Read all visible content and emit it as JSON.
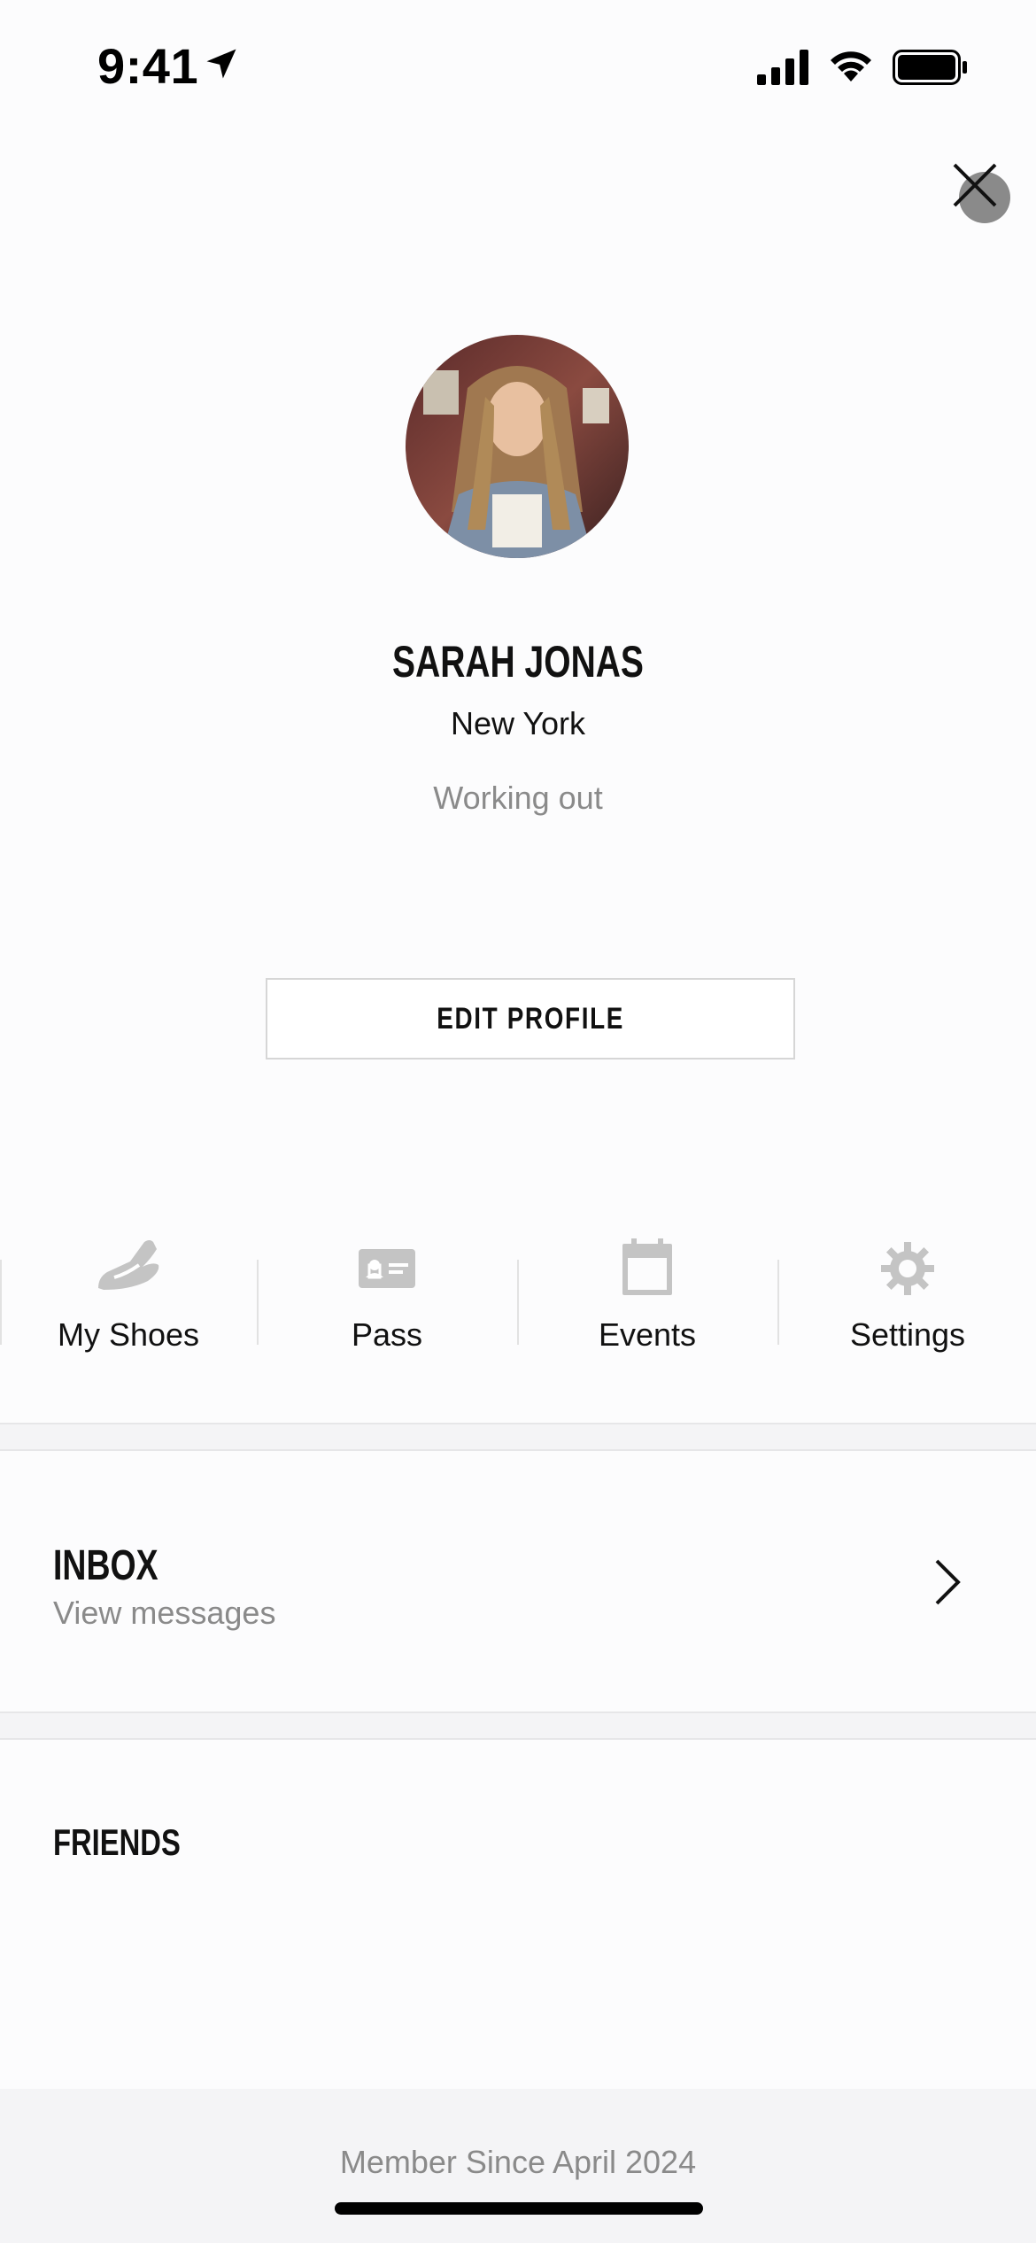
{
  "status_bar": {
    "time": "9:41"
  },
  "profile": {
    "name": "SARAH JONAS",
    "city": "New York",
    "status": "Working out"
  },
  "actions": {
    "edit_profile": "EDIT PROFILE"
  },
  "shortcuts": [
    {
      "label": "My Shoes",
      "icon": "shoe-icon"
    },
    {
      "label": "Pass",
      "icon": "id-card-icon"
    },
    {
      "label": "Events",
      "icon": "calendar-icon"
    },
    {
      "label": "Settings",
      "icon": "gear-icon"
    }
  ],
  "inbox": {
    "title": "INBOX",
    "subtitle": "View messages"
  },
  "friends": {
    "title": "FRIENDS"
  },
  "footer": {
    "member_since": "Member Since April 2024"
  },
  "colors": {
    "text_primary": "#111111",
    "text_secondary": "#8a8a8a",
    "icon_gray": "#c4c4c4",
    "divider": "#e2e2e2"
  }
}
